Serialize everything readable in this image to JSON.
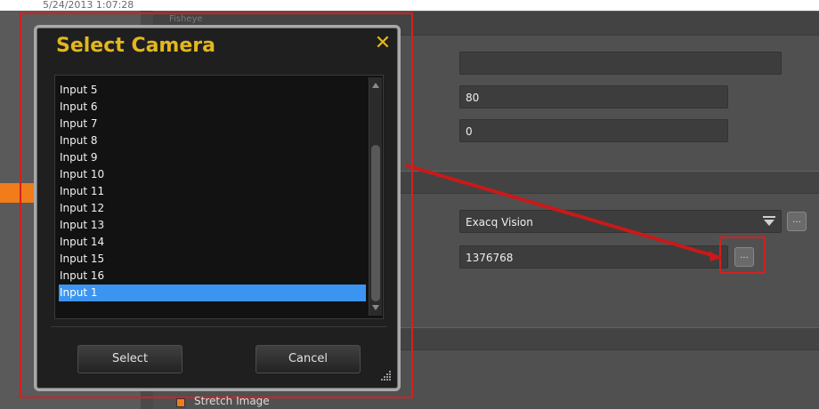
{
  "app": {
    "timestamp": "5/24/2013 1:07:28",
    "section_label": "Fisheye"
  },
  "main": {
    "fields": {
      "top_empty": "",
      "value_80": "80",
      "value_0": "0",
      "vendor": "Exacq Vision",
      "camera_id": "1376768"
    },
    "small_buttons": {
      "vendor_more": "...",
      "camera_more": "..."
    },
    "checkbox": {
      "label": "Stretch Image"
    }
  },
  "dialog": {
    "title": "Select Camera",
    "close": "✕",
    "items": [
      "Input 5",
      "Input 6",
      "Input 7",
      "Input 8",
      "Input 9",
      "Input 10",
      "Input 11",
      "Input 12",
      "Input 13",
      "Input 14",
      "Input 15",
      "Input 16",
      "Input 1"
    ],
    "selected_index": 12,
    "buttons": {
      "select": "Select",
      "cancel": "Cancel"
    }
  },
  "colors": {
    "accent": "#e3b71e",
    "selection": "#3b94ef",
    "highlight": "#d61f1f",
    "orange": "#f07d1a"
  }
}
